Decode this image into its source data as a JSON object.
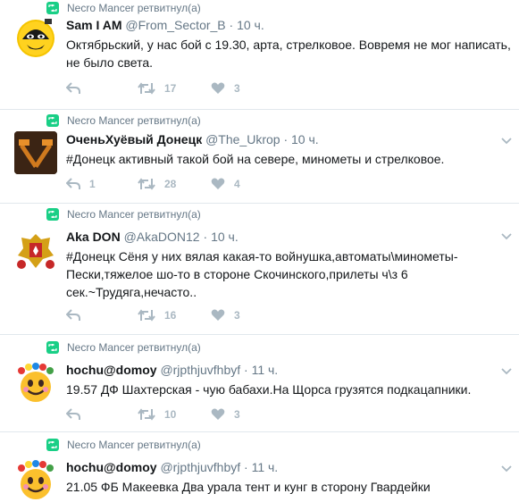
{
  "tweets": [
    {
      "retweeter": "Necro Mancer ретвитнул(а)",
      "name": "Sam I AM",
      "handle": "@From_Sector_B",
      "dot": "·",
      "time": "10 ч.",
      "text": "Октябрьский, у нас бой с 19.30, арта, стрелковое. Вовремя не мог написать, не было света.",
      "replies": "",
      "retweets": "17",
      "likes": "3"
    },
    {
      "retweeter": "Necro Mancer ретвитнул(а)",
      "name": "ОченьХуёвый Донецк",
      "handle": "@The_Ukrop",
      "dot": "·",
      "time": "10 ч.",
      "text": "#Донецк активный такой бой на севере, минометы и стрелковое.",
      "replies": "1",
      "retweets": "28",
      "likes": "4"
    },
    {
      "retweeter": "Necro Mancer ретвитнул(а)",
      "name": "Aka DON",
      "handle": "@AkaDON12",
      "dot": "·",
      "time": "10 ч.",
      "text": "#Донецк Сёня у них вялая какая-то войнушка,автоматы\\минометы- Пески,тяжелое шо-то в стороне Скочинского,прилеты ч\\з 6 сек.~Трудяга,нечасто..",
      "replies": "",
      "retweets": "16",
      "likes": "3"
    },
    {
      "retweeter": "Necro Mancer ретвитнул(а)",
      "name": "hochu@domoy",
      "handle": "@rjpthjuvfhbyf",
      "dot": "·",
      "time": "11 ч.",
      "text": "19.57 ДФ Шахтерская - чую бабахи.На Щорса грузятся подкацапники.",
      "replies": "",
      "retweets": "10",
      "likes": "3"
    },
    {
      "retweeter": "Necro Mancer ретвитнул(а)",
      "name": "hochu@domoy",
      "handle": "@rjpthjuvfhbyf",
      "dot": "·",
      "time": "11 ч.",
      "text": "21.05 ФБ Макеевка Два урала тент и кунг в сторону Гвардейки",
      "replies": "",
      "retweets": "",
      "likes": ""
    }
  ],
  "colors": {
    "retweet_green": "#19cf86",
    "muted": "#657786",
    "action_gray": "#aab8c2",
    "divider": "#e1e8ed"
  },
  "icons": [
    "retweet-icon",
    "reply-icon",
    "like-icon",
    "chevron-down-icon"
  ]
}
